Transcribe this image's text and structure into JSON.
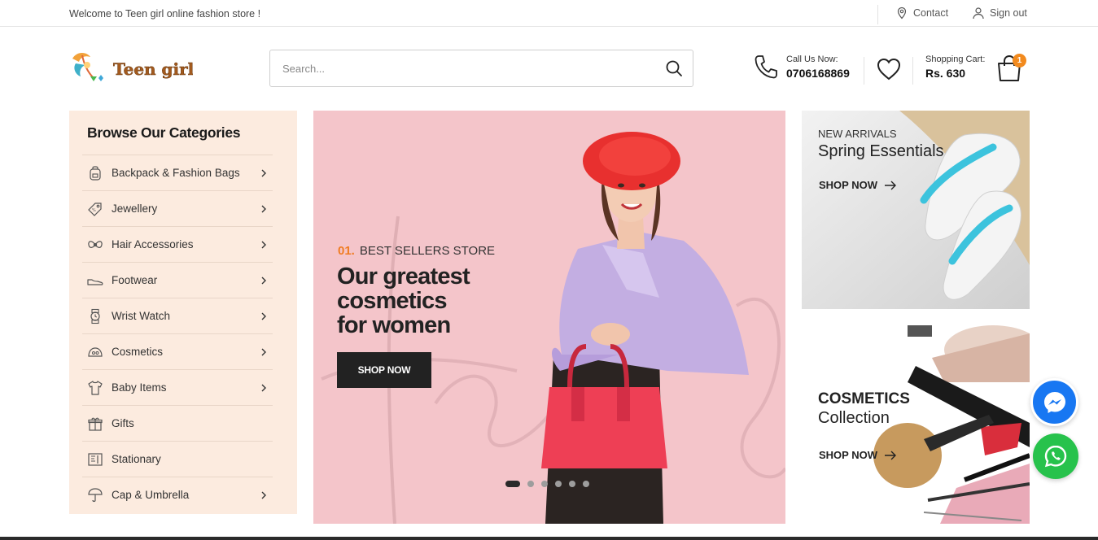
{
  "topbar": {
    "welcome": "Welcome to Teen girl online fashion store !",
    "contact": "Contact",
    "signout": "Sign out"
  },
  "logo": {
    "text": "Teen girl"
  },
  "search": {
    "placeholder": "Search...",
    "value": ""
  },
  "call": {
    "label": "Call Us Now:",
    "phone": "0706168869"
  },
  "cart": {
    "label": "Shopping Cart:",
    "total": "Rs. 630",
    "count": "1"
  },
  "categories": {
    "title": "Browse Our Categories",
    "items": [
      {
        "label": "Backpack & Fashion Bags",
        "icon": "backpack-icon",
        "has_sub": true
      },
      {
        "label": "Jewellery",
        "icon": "jewellery-tag-icon",
        "has_sub": true
      },
      {
        "label": "Hair Accessories",
        "icon": "hair-bow-icon",
        "has_sub": true
      },
      {
        "label": "Footwear",
        "icon": "shoe-icon",
        "has_sub": true
      },
      {
        "label": "Wrist Watch",
        "icon": "watch-icon",
        "has_sub": true
      },
      {
        "label": "Cosmetics",
        "icon": "cosmetics-icon",
        "has_sub": true
      },
      {
        "label": "Baby Items",
        "icon": "baby-onesie-icon",
        "has_sub": true
      },
      {
        "label": "Gifts",
        "icon": "gift-icon",
        "has_sub": false
      },
      {
        "label": "Stationary",
        "icon": "stationary-icon",
        "has_sub": false
      },
      {
        "label": "Cap & Umbrella",
        "icon": "cap-umbrella-icon",
        "has_sub": true
      }
    ]
  },
  "hero": {
    "number": "01.",
    "kicker": "BEST SELLERS STORE",
    "headline": [
      "Our greatest",
      "cosmetics",
      "for women"
    ],
    "button": "SHOP NOW",
    "slides": 6,
    "active_slide": 1
  },
  "banners": [
    {
      "subtitle": "NEW ARRIVALS",
      "title": "Spring Essentials",
      "button": "SHOP NOW"
    },
    {
      "subtitle": "COSMETICS",
      "title": "Collection",
      "button": "SHOP NOW"
    }
  ],
  "colors": {
    "accent": "#f07c22",
    "category_bg": "#fcebdf",
    "hero_bg": "#f4c5ca",
    "dark": "#222222",
    "messenger": "#1877f2",
    "whatsapp": "#27c24c"
  }
}
